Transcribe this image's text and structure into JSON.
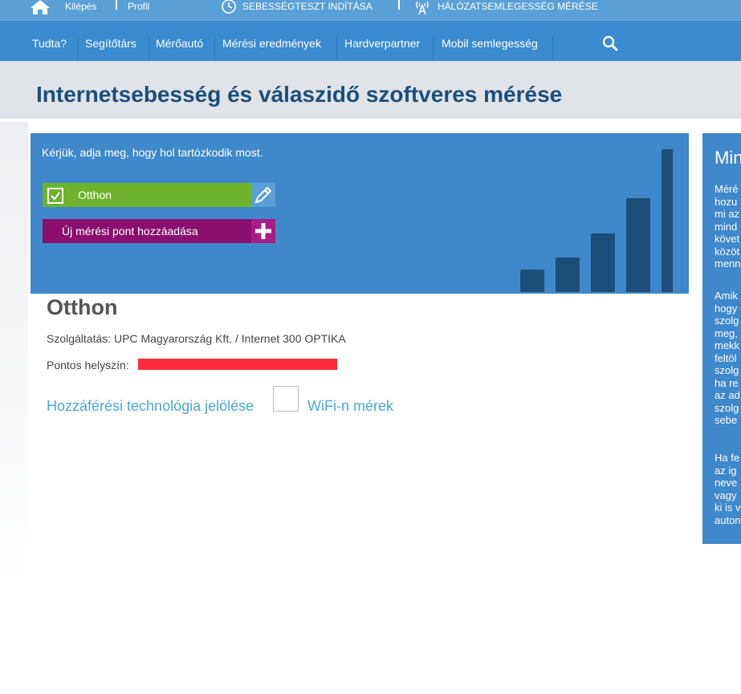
{
  "topbar": {
    "logout": "Kilépés",
    "profile": "Profil",
    "speedtest": "SEBESSÉGTESZT INDÍTÁSA",
    "neutrality": "HÁLÓZATSEMLEGESSÉG MÉRÉSE"
  },
  "nav": {
    "items": [
      {
        "label": "Tudta?"
      },
      {
        "label": "Segítőtárs"
      },
      {
        "label": "Mérőautó"
      },
      {
        "label": "Mérési eredmények"
      },
      {
        "label": "Hardverpartner"
      },
      {
        "label": "Mobil semlegesség"
      }
    ]
  },
  "page": {
    "title": "Internetsebesség és válaszidő szoftveres mérése"
  },
  "panel": {
    "prompt": "Kérjük, adja meg, hogy hol tartózkodik most.",
    "location_button": "Otthon",
    "add_button": "Új mérési pont hozzáadása",
    "signal_levels": [
      0.16,
      0.24,
      0.41,
      0.66,
      1.0
    ]
  },
  "content": {
    "title": "Otthon",
    "service": "Szolgáltatás: UPC Magyarország Kft. / Internet 300 OPTIKA",
    "location_label": "Pontos helyszín:",
    "access_tech": "Hozzáférési technológia jelölése",
    "wifi_label": "WiFi-n mérek"
  },
  "right_panel": {
    "title": "Min",
    "paragraphs": [
      "Méré\nhozu\nmi az\nmind\nkövet\nközöt\nmenn",
      "Amik\nhogy\nszolg\nmeg,\nmekk\nfeltöl\nszolg\nha re\naz ad\nszolg\nsebe",
      "Ha fe\naz ig\nneve\nvagy\nki is v\nauton"
    ]
  },
  "colors": {
    "topbar": "#5aa0d6",
    "navbar": "#3a8bd0",
    "panel": "#3f88cc",
    "title": "#1b4f7a",
    "location_button": "#6db42c",
    "add_button": "#8a0f6e",
    "link": "#4aa7d6",
    "signal_bar": "#1b4f7a"
  }
}
